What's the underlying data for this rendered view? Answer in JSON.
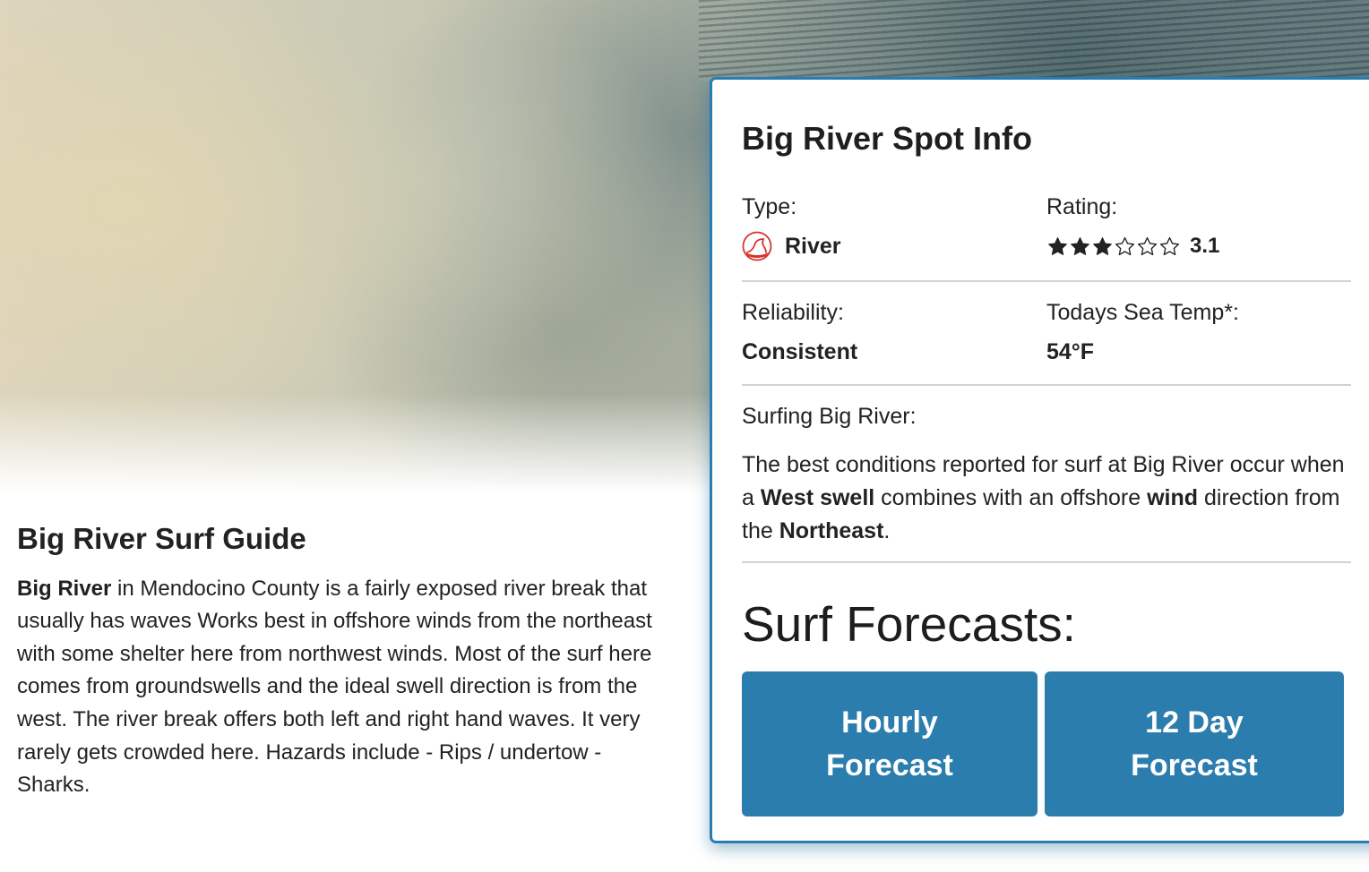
{
  "guide": {
    "title": "Big River Surf Guide",
    "spot_name": "Big River",
    "description": " in Mendocino County is a fairly exposed river break that usually has waves Works best in offshore winds from the northeast with some shelter here from northwest winds. Most of the surf here comes from groundswells and the ideal swell direction is from the west. The river break offers both left and right hand waves. It very rarely gets crowded here. Hazards include - Rips / undertow - Sharks."
  },
  "card": {
    "title": "Big River Spot Info",
    "type_label": "Type:",
    "type_value": "River",
    "type_icon": "river-break-icon",
    "rating_label": "Rating:",
    "rating_value": "3.1",
    "rating_stars_filled": 3,
    "rating_stars_total": 6,
    "reliability_label": "Reliability:",
    "reliability_value": "Consistent",
    "sea_temp_label": "Todays Sea Temp*:",
    "sea_temp_value": "54°F",
    "surfing_label": "Surfing Big River:",
    "surfing_text": {
      "part1": "The best conditions reported for surf at Big River occur when a ",
      "swell": "West swell",
      "part2": " combines with an offshore ",
      "wind": "wind",
      "part3": " direction from the ",
      "direction": "Northeast",
      "part4": "."
    },
    "forecasts_title": "Surf Forecasts:",
    "hourly_button": "Hourly Forecast",
    "twelve_day_button": "12 Day Forecast"
  },
  "colors": {
    "accent": "#2a7dad",
    "card_border": "#2a7db1",
    "text": "#222222",
    "icon_red": "#d9332b"
  }
}
